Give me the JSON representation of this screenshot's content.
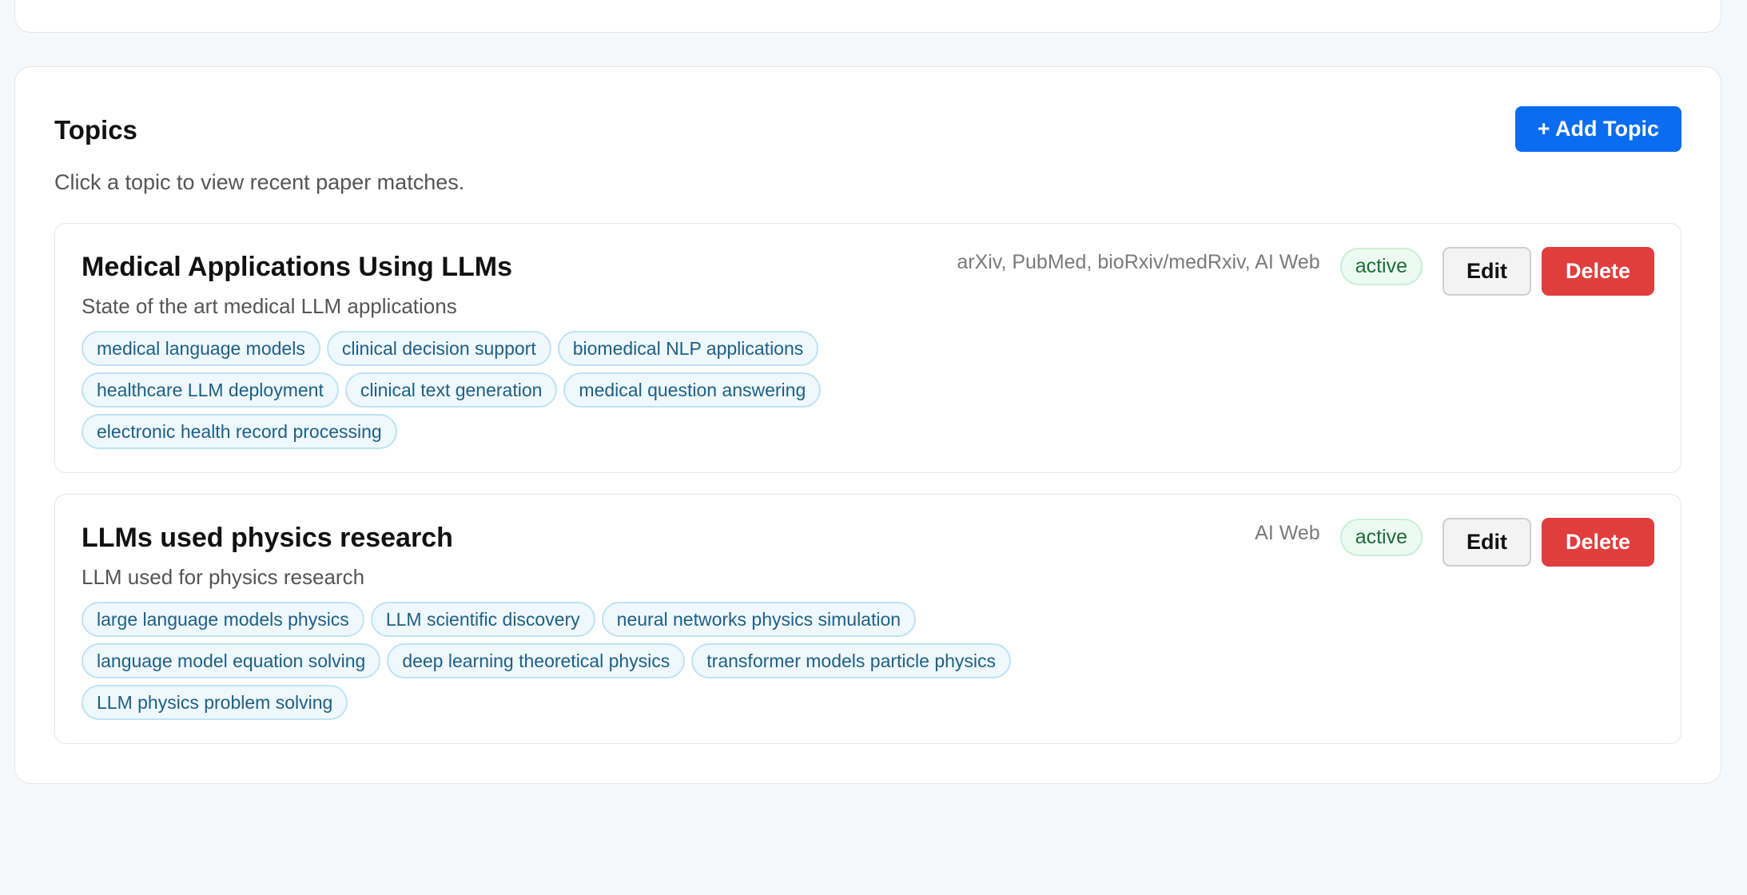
{
  "topics_panel": {
    "title": "Topics",
    "subtitle": "Click a topic to view recent paper matches.",
    "add_topic_label": "+ Add Topic"
  },
  "topics": [
    {
      "name": "Medical Applications Using LLMs",
      "description": "State of the art medical LLM applications",
      "sources": "arXiv, PubMed, bioRxiv/medRxiv, AI Web",
      "status": "active",
      "edit_label": "Edit",
      "delete_label": "Delete",
      "keyword_rows": [
        [
          "medical language models",
          "clinical decision support",
          "biomedical NLP applications"
        ],
        [
          "healthcare LLM deployment",
          "clinical text generation",
          "medical question answering"
        ],
        [
          "electronic health record processing"
        ]
      ]
    },
    {
      "name": "LLMs used physics research",
      "description": "LLM used for physics research",
      "sources": "AI Web",
      "status": "active",
      "edit_label": "Edit",
      "delete_label": "Delete",
      "keyword_rows": [
        [
          "large language models physics",
          "LLM scientific discovery",
          "neural networks physics simulation"
        ],
        [
          "language model equation solving",
          "deep learning theoretical physics",
          "transformer models particle physics"
        ],
        [
          "LLM physics problem solving"
        ]
      ]
    }
  ],
  "colors": {
    "page_background": "#f7f8fa",
    "primary_button": "#0a6cf0",
    "delete_button": "#e03d3d",
    "active_badge_bg": "#ecfbf1",
    "active_badge_text": "#1e6b3a",
    "keyword_chip_bg": "#eef8fd",
    "keyword_chip_text": "#1f5f85"
  }
}
